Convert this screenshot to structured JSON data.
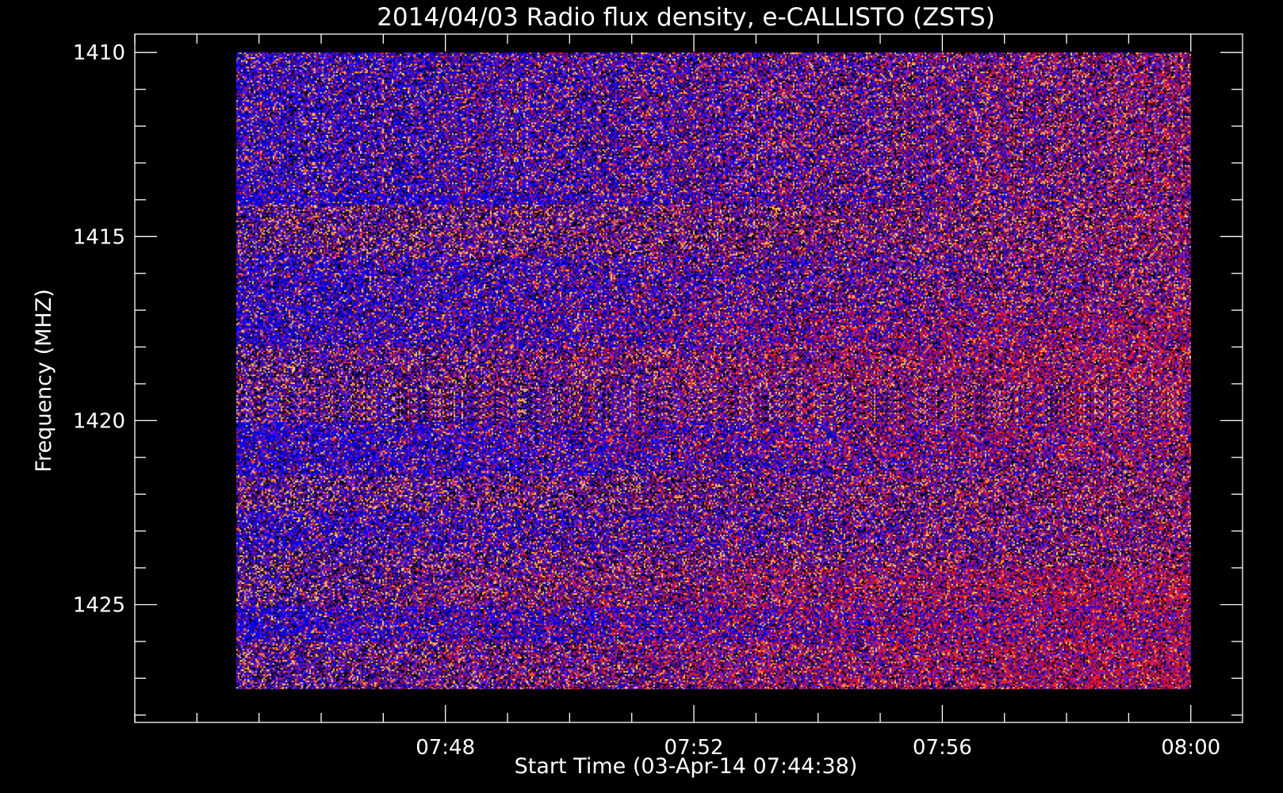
{
  "chart_data": {
    "type": "heatmap",
    "title": "2014/04/03  Radio flux density, e-CALLISTO (ZSTS)",
    "xlabel": "Start Time (03-Apr-14 07:44:38)",
    "ylabel": "Frequency (MHZ)",
    "x_range": [
      "07:44:38",
      "08:00:00"
    ],
    "x_axis_range": [
      "07:43:00",
      "08:00:50"
    ],
    "y_range": [
      1410,
      1427.3
    ],
    "y_axis_range": [
      1409.5,
      1428.2
    ],
    "y_inverted": true,
    "x_ticks": [
      "07:48",
      "07:52",
      "07:56",
      "08:00"
    ],
    "x_minor_tick_interval_minutes": 1,
    "y_ticks": [
      1410,
      1415,
      1420,
      1425
    ],
    "y_minor_tick_interval_mhz": 1,
    "colormap": [
      "#000000",
      "#3a0a7a",
      "#6a1fd0",
      "#0000ff",
      "#8a0a5a",
      "#d01030",
      "#ff2020",
      "#ff8040",
      "#ffd060"
    ],
    "description_of_values": "Noisy spectrogram: strong blue horizontal bands near 1410-1414, 1415.5-1418, 1420-1421.5, 1422.5-1423.5 and 1425-1426 MHz on the left; intensity shifts toward red/orange on the right side, most strongly near 1424-1427 MHz after 07:55.",
    "grid": false,
    "legend": "none"
  },
  "colors": {
    "background": "#000000",
    "axes": "#ffffff",
    "text": "#ffffff"
  }
}
